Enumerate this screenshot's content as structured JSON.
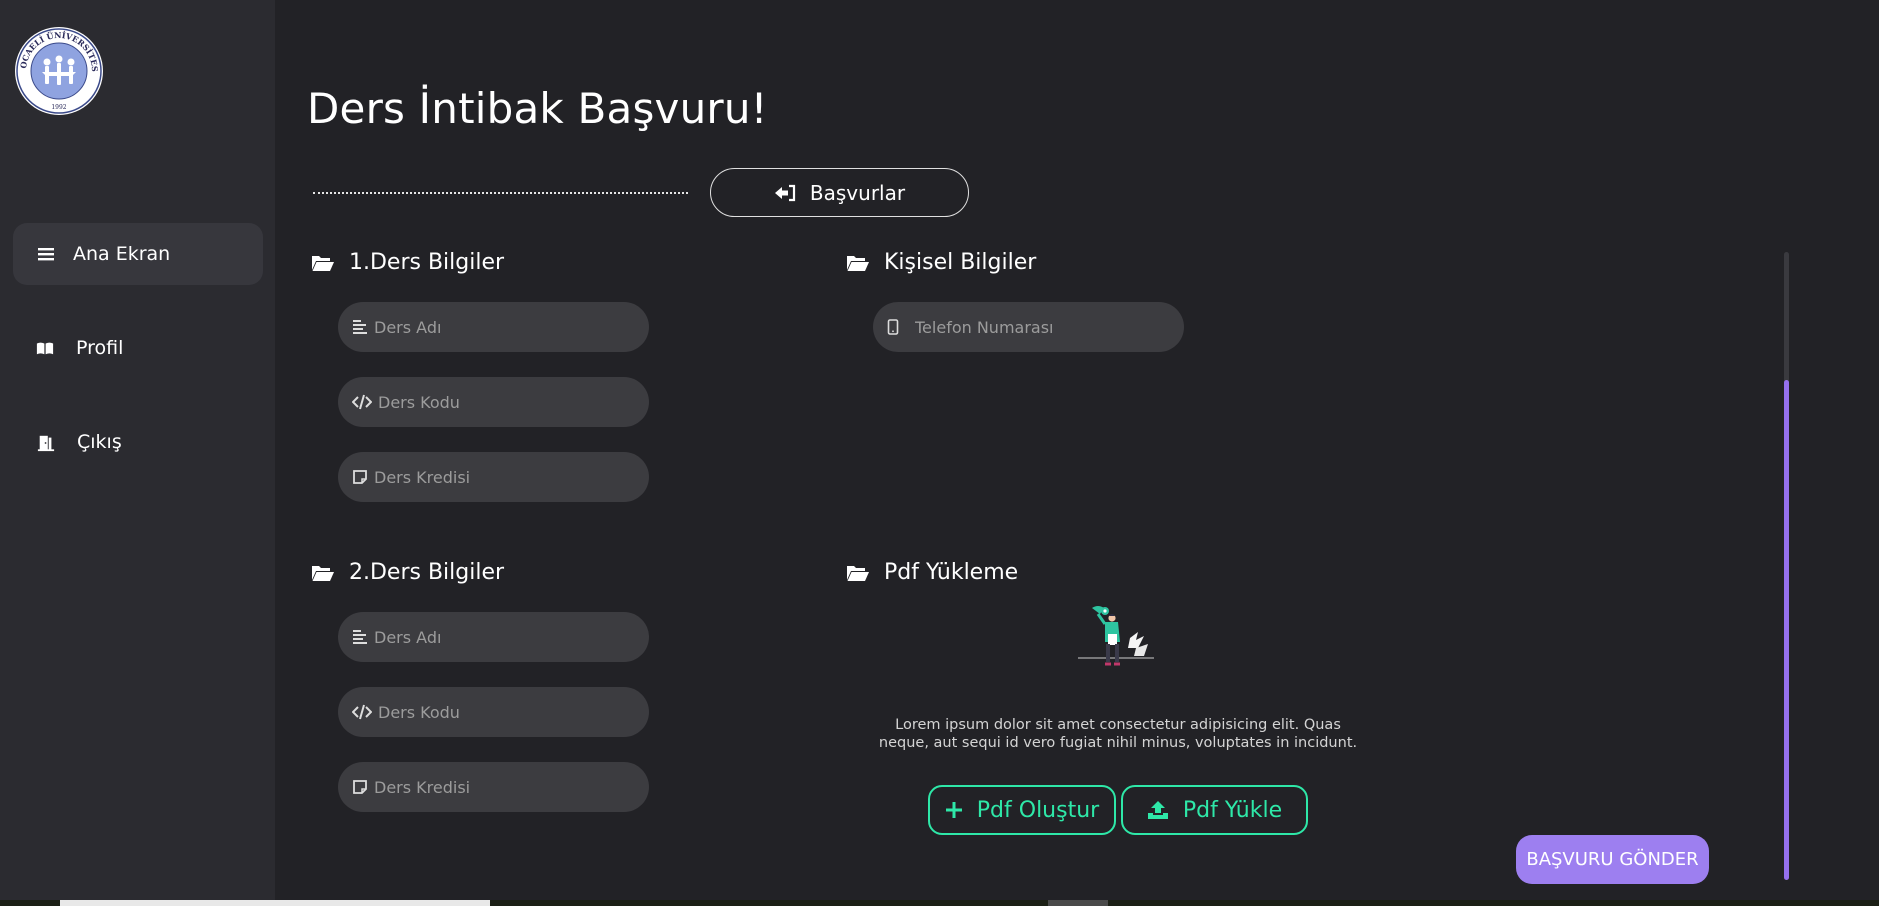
{
  "sidebar": {
    "logo_text": "KOCAELİ ÜNİVERSİTESİ",
    "logo_year": "1992",
    "items": [
      {
        "label": "Ana Ekran",
        "icon": "menu-icon",
        "active": true
      },
      {
        "label": "Profil",
        "icon": "book-icon",
        "active": false
      },
      {
        "label": "Çıkış",
        "icon": "door-exit-icon",
        "active": false
      }
    ]
  },
  "main": {
    "title": "Ders İntibak Başvuru!",
    "applications_button": "Başvurlar",
    "course1": {
      "heading": "1.Ders Bilgiler",
      "name_placeholder": "Ders Adı",
      "code_placeholder": "Ders Kodu",
      "credit_placeholder": "Ders Kredisi"
    },
    "course2": {
      "heading": "2.Ders Bilgiler",
      "name_placeholder": "Ders Adı",
      "code_placeholder": "Ders Kodu",
      "credit_placeholder": "Ders Kredisi"
    },
    "personal": {
      "heading": "Kişisel Bilgiler",
      "phone_placeholder": "Telefon Numarası"
    },
    "pdf": {
      "heading": "Pdf Yükleme",
      "description": "Lorem ipsum dolor sit amet consectetur adipisicing elit. Quas neque, aut sequi id vero fugiat nihil minus, voluptates in incidunt.",
      "create_button": "Pdf Oluştur",
      "upload_button": "Pdf Yükle"
    },
    "submit_button": "BAŞVURU GÖNDER"
  },
  "colors": {
    "background": "#222226",
    "sidebar": "#2b2b30",
    "field": "#3c3c40",
    "accent_green": "#2ee8a8",
    "accent_purple": "#9d7ff0"
  }
}
